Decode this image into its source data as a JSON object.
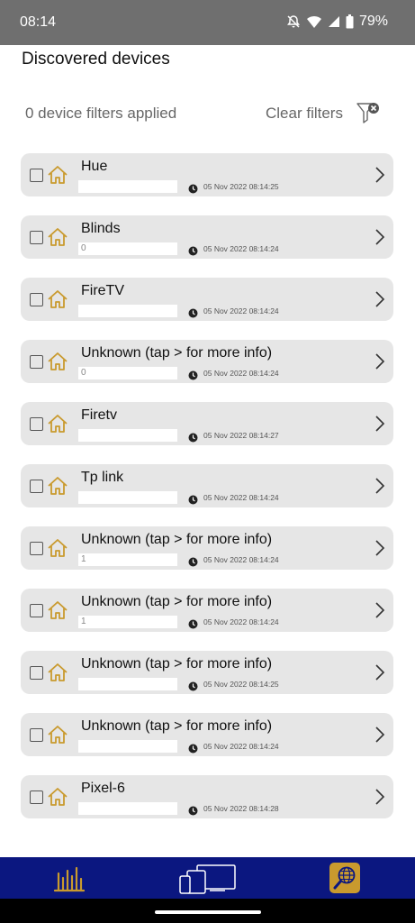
{
  "status_bar": {
    "time": "08:14",
    "battery": "79%"
  },
  "header": {
    "title": "Discovered devices"
  },
  "filters": {
    "count_label": "0 device filters applied",
    "clear_label": "Clear filters"
  },
  "devices": [
    {
      "name": "Hue",
      "ip": "",
      "timestamp": "05 Nov 2022 08:14:25"
    },
    {
      "name": "Blinds",
      "ip": "0",
      "timestamp": "05 Nov 2022 08:14:24"
    },
    {
      "name": "FireTV",
      "ip": "",
      "timestamp": "05 Nov 2022 08:14:24"
    },
    {
      "name": "Unknown (tap > for more info)",
      "ip": "0",
      "timestamp": "05 Nov 2022 08:14:24"
    },
    {
      "name": "Firetv",
      "ip": "",
      "timestamp": "05 Nov 2022 08:14:27"
    },
    {
      "name": "Tp link",
      "ip": "",
      "timestamp": "05 Nov 2022 08:14:24"
    },
    {
      "name": "Unknown (tap > for more info)",
      "ip": "1",
      "timestamp": "05 Nov 2022 08:14:24"
    },
    {
      "name": "Unknown (tap > for more info)",
      "ip": "1",
      "timestamp": "05 Nov 2022 08:14:24"
    },
    {
      "name": "Unknown (tap > for more info)",
      "ip": "",
      "timestamp": "05 Nov 2022 08:14:25"
    },
    {
      "name": "Unknown (tap > for more info)",
      "ip": "",
      "timestamp": "05 Nov 2022 08:14:24"
    },
    {
      "name": "Pixel-6",
      "ip": "",
      "timestamp": "05 Nov 2022 08:14:28"
    }
  ],
  "icons": {
    "device": "home-icon",
    "timestamp": "clock-icon",
    "open": "chevron-right-icon",
    "filter": "filter-clear-icon",
    "nav": [
      "bar-chart-icon",
      "devices-icon",
      "globe-search-icon"
    ]
  },
  "colors": {
    "accent_gold": "#c99a2e",
    "nav_blue": "#0b1780",
    "card_bg": "#e6e6e6"
  }
}
